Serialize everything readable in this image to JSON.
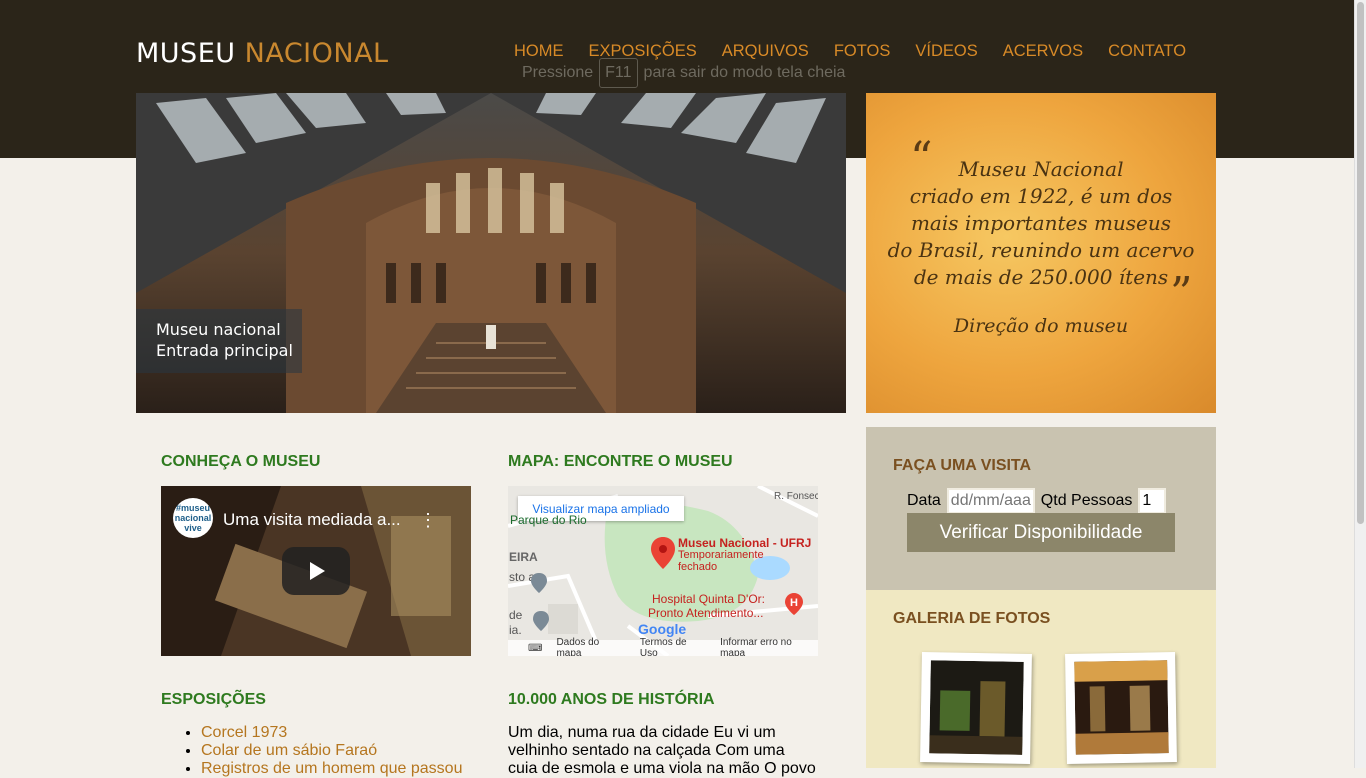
{
  "header": {
    "logo_part1": "MUSEU",
    "logo_part2": "NACIONAL",
    "nav": [
      "HOME",
      "EXPOSIÇÕES",
      "ARQUIVOS",
      "FOTOS",
      "VÍDEOS",
      "ACERVOS",
      "CONTATO"
    ],
    "fullscreen_msg_before": "Pressione",
    "fullscreen_key": "F11",
    "fullscreen_msg_after": "para sair do modo tela cheia"
  },
  "hero": {
    "caption_line1": "Museu nacional",
    "caption_line2": "Entrada principal"
  },
  "quote": {
    "open_mark": "“",
    "close_mark": "”",
    "lines": [
      "Museu Nacional",
      "criado em 1922, é um dos",
      "mais importantes museus",
      "do Brasil, reunindo um acervo",
      "de mais de 250.000 ítens"
    ],
    "author": "Direção do museu"
  },
  "sections": {
    "conheca": "CONHEÇA O MUSEU",
    "mapa": "MAPA: ENCONTRE O MUSEU",
    "exposicoes": "ESPOSIÇÕES",
    "historia": "10.000 ANOS DE HISTÓRIA"
  },
  "video": {
    "title": "Uma visita mediada a...",
    "channel": "#museu nacional vive",
    "menu_icon": "⋮"
  },
  "map": {
    "enlarge": "Visualizar mapa ampliado",
    "place_name": "Museu Nacional - UFRJ",
    "place_status_1": "Temporariamente",
    "place_status_2": "fechado",
    "hospital_1": "Hospital Quinta D'Or:",
    "hospital_2": "Pronto Atendimento...",
    "park": "Parque do Rio",
    "road": "R. Fonseca",
    "side_1": "EIRA",
    "side_2": "sto a",
    "side_3": "de",
    "side_4": "ia.",
    "google": "Google",
    "footer": [
      "Dados do mapa",
      "Termos de Uso",
      "Informar erro no mapa"
    ]
  },
  "exhibitions": [
    "Corcel 1973",
    "Colar de um sábio Faraó",
    "Registros de um homem que passou"
  ],
  "history_text": "Um dia, numa rua da cidade Eu vi um velhinho sentado na calçada Com uma cuia de esmola e uma viola na mão O povo",
  "visit": {
    "title": "FAÇA UMA VISITA",
    "date_label": "Data",
    "date_placeholder": "dd/mm/aaaa",
    "qty_label": "Qtd Pessoas",
    "qty_value": "1",
    "button": "Verificar Disponibilidade"
  },
  "gallery": {
    "title": "GALERIA DE FOTOS"
  },
  "colors": {
    "header_bg": "#2b2519",
    "nav": "#d88a27",
    "section_title": "#2e7a1f",
    "link": "#b5761f",
    "visit_bg": "#c9c3b0",
    "gallery_bg": "#f0e8c2"
  }
}
